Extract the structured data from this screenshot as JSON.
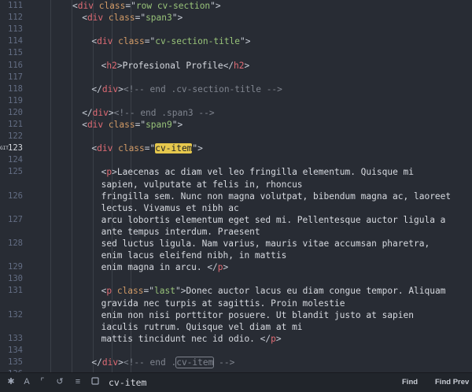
{
  "editor": {
    "lines": [
      {
        "num": "111",
        "segs": [
          [
            "p",
            "<"
          ],
          [
            "t",
            "div"
          ],
          [
            "a",
            " class"
          ],
          [
            "p",
            "=\""
          ],
          [
            "s",
            "row cv-section"
          ],
          [
            "p",
            "\">"
          ]
        ],
        "indent": 4
      },
      {
        "num": "112",
        "segs": [
          [
            "p",
            "<"
          ],
          [
            "t",
            "div"
          ],
          [
            "a",
            " class"
          ],
          [
            "p",
            "=\""
          ],
          [
            "s",
            "span3"
          ],
          [
            "p",
            "\">"
          ]
        ],
        "indent": 6
      },
      {
        "num": "113",
        "segs": [],
        "indent": 0
      },
      {
        "num": "114",
        "segs": [
          [
            "p",
            "<"
          ],
          [
            "t",
            "div"
          ],
          [
            "a",
            " class"
          ],
          [
            "p",
            "=\""
          ],
          [
            "s",
            "cv-section-title"
          ],
          [
            "p",
            "\">"
          ]
        ],
        "indent": 8
      },
      {
        "num": "115",
        "segs": [],
        "indent": 0
      },
      {
        "num": "116",
        "segs": [
          [
            "p",
            "<"
          ],
          [
            "t",
            "h2"
          ],
          [
            "p",
            ">"
          ],
          [
            "tx",
            "Profesional Profile"
          ],
          [
            "p",
            "</"
          ],
          [
            "t",
            "h2"
          ],
          [
            "p",
            ">"
          ]
        ],
        "indent": 10
      },
      {
        "num": "117",
        "segs": [],
        "indent": 0
      },
      {
        "num": "118",
        "segs": [
          [
            "p",
            "</"
          ],
          [
            "t",
            "div"
          ],
          [
            "p",
            ">"
          ],
          [
            "c",
            "<!-- end .cv-section-title -->"
          ]
        ],
        "indent": 8
      },
      {
        "num": "119",
        "segs": [],
        "indent": 0
      },
      {
        "num": "120",
        "segs": [
          [
            "p",
            "</"
          ],
          [
            "t",
            "div"
          ],
          [
            "p",
            ">"
          ],
          [
            "c",
            "<!-- end .span3 -->"
          ]
        ],
        "indent": 6
      },
      {
        "num": "121",
        "segs": [
          [
            "p",
            "<"
          ],
          [
            "t",
            "div"
          ],
          [
            "a",
            " class"
          ],
          [
            "p",
            "=\""
          ],
          [
            "s",
            "span9"
          ],
          [
            "p",
            "\">"
          ]
        ],
        "indent": 6
      },
      {
        "num": "122",
        "segs": [],
        "indent": 0
      },
      {
        "num": "123",
        "segs": [
          [
            "p",
            "<"
          ],
          [
            "t",
            "div"
          ],
          [
            "a",
            " class"
          ],
          [
            "p",
            "=\""
          ],
          [
            "hl",
            "cv-item"
          ],
          [
            "p",
            "\">"
          ]
        ],
        "indent": 8,
        "active": true
      },
      {
        "num": "124",
        "segs": [],
        "indent": 0
      },
      {
        "num": "125",
        "segs": [
          [
            "p",
            "<"
          ],
          [
            "t",
            "p"
          ],
          [
            "p",
            ">"
          ],
          [
            "tx",
            "Laecenas ac diam vel leo fringilla elementum. Quisque mi"
          ]
        ],
        "indent": 10
      },
      {
        "num": "",
        "segs": [
          [
            "tx",
            "sapien, vulputate at felis in, rhoncus"
          ]
        ],
        "indent": 10
      },
      {
        "num": "126",
        "segs": [
          [
            "tx",
            "fringilla sem. Nunc non magna volutpat, bibendum magna ac, laoreet"
          ]
        ],
        "indent": 10
      },
      {
        "num": "",
        "segs": [
          [
            "tx",
            "lectus. Vivamus et nibh ac"
          ]
        ],
        "indent": 10
      },
      {
        "num": "127",
        "segs": [
          [
            "tx",
            "arcu lobortis elementum eget sed mi. Pellentesque auctor ligula a"
          ]
        ],
        "indent": 10
      },
      {
        "num": "",
        "segs": [
          [
            "tx",
            "ante tempus interdum. Praesent"
          ]
        ],
        "indent": 10
      },
      {
        "num": "128",
        "segs": [
          [
            "tx",
            "sed luctus ligula. Nam varius, mauris vitae accumsan pharetra,"
          ]
        ],
        "indent": 10
      },
      {
        "num": "",
        "segs": [
          [
            "tx",
            "enim lacus eleifend nibh, in mattis"
          ]
        ],
        "indent": 10
      },
      {
        "num": "129",
        "segs": [
          [
            "tx",
            "enim magna in arcu. "
          ],
          [
            "p",
            "</"
          ],
          [
            "t",
            "p"
          ],
          [
            "p",
            ">"
          ]
        ],
        "indent": 10
      },
      {
        "num": "130",
        "segs": [],
        "indent": 0
      },
      {
        "num": "131",
        "segs": [
          [
            "p",
            "<"
          ],
          [
            "t",
            "p"
          ],
          [
            "a",
            " class"
          ],
          [
            "p",
            "=\""
          ],
          [
            "s",
            "last"
          ],
          [
            "p",
            "\">"
          ],
          [
            "tx",
            "Donec auctor lacus eu diam congue tempor. Aliquam"
          ]
        ],
        "indent": 10
      },
      {
        "num": "",
        "segs": [
          [
            "tx",
            "gravida nec turpis at sagittis. Proin molestie"
          ]
        ],
        "indent": 10
      },
      {
        "num": "132",
        "segs": [
          [
            "tx",
            "enim non nisi porttitor posuere. Ut blandit justo at sapien"
          ]
        ],
        "indent": 10
      },
      {
        "num": "",
        "segs": [
          [
            "tx",
            "iaculis rutrum. Quisque vel diam at mi"
          ]
        ],
        "indent": 10
      },
      {
        "num": "133",
        "segs": [
          [
            "tx",
            "mattis tincidunt nec id odio. "
          ],
          [
            "p",
            "</"
          ],
          [
            "t",
            "p"
          ],
          [
            "p",
            ">"
          ]
        ],
        "indent": 10
      },
      {
        "num": "134",
        "segs": [],
        "indent": 0
      },
      {
        "num": "135",
        "segs": [
          [
            "p",
            "</"
          ],
          [
            "t",
            "div"
          ],
          [
            "p",
            ">"
          ],
          [
            "c",
            "<!-- end ."
          ],
          [
            "ol",
            "cv-item"
          ],
          [
            "c",
            " -->"
          ]
        ],
        "indent": 8
      },
      {
        "num": "136",
        "segs": [],
        "indent": 0
      }
    ],
    "git_marker": "GIT"
  },
  "statusbar": {
    "search_term": "cv-item",
    "find_label": "Find",
    "find_prev_label": "Find Prev",
    "icons": [
      "regex-icon",
      "case-sensitive-icon",
      "selection-icon",
      "wrap-icon",
      "whole-word-icon",
      "checkbox-icon"
    ]
  },
  "colors": {
    "background": "#282c34",
    "statusbar": "#21252b",
    "tag": "#e5c07b",
    "string": "#98c379",
    "comment": "#7f848e",
    "highlight": "#e6c84d"
  }
}
